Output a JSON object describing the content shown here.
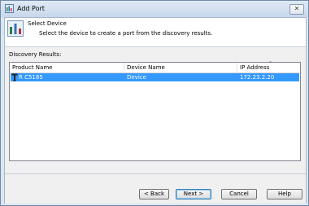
{
  "window": {
    "title": "Add Port",
    "close_label": "✕"
  },
  "header": {
    "title": "Select Device",
    "description": "Select the device to create a port from the discovery results."
  },
  "results": {
    "label": "Discovery Results:",
    "columns": [
      "Product Name",
      "Device Name",
      "IP Address"
    ],
    "sort_indicator": "^",
    "rows": [
      {
        "product": "R C5185",
        "device": "Device",
        "ip": "172.23.2.20",
        "selected": true
      }
    ]
  },
  "buttons": {
    "back": "< Back",
    "next": "Next >",
    "cancel": "Cancel",
    "help": "Help"
  },
  "colors": {
    "selection": "#3399ff",
    "title_bar": "#c7d8ec"
  },
  "icons": {
    "window": "add-port-icon",
    "header": "device-wizard-icon",
    "row": "printer-icon"
  }
}
